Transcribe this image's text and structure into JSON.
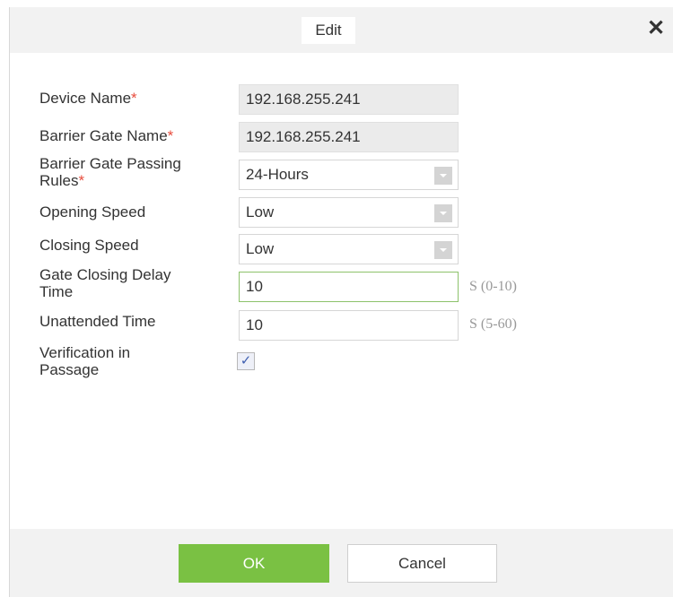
{
  "dialog": {
    "title": "Edit",
    "close_icon": "close-icon"
  },
  "form": {
    "device_name": {
      "label": "Device Name",
      "required_mark": "*",
      "value": "192.168.255.241"
    },
    "barrier_gate_name": {
      "label": "Barrier Gate Name",
      "required_mark": "*",
      "value": "192.168.255.241"
    },
    "passing_rules": {
      "label_line1": "Barrier Gate Passing",
      "label_line2": "Rules",
      "required_mark": "*",
      "value": "24-Hours"
    },
    "opening_speed": {
      "label": "Opening Speed",
      "value": "Low"
    },
    "closing_speed": {
      "label": "Closing Speed",
      "value": "Low"
    },
    "gate_closing_delay": {
      "label_line1": "Gate Closing Delay",
      "label_line2": "Time",
      "value": "10",
      "unit": "S",
      "range": "(0-10)"
    },
    "unattended_time": {
      "label": "Unattended Time",
      "value": "10",
      "unit": "S",
      "range": "(5-60)"
    },
    "verification": {
      "label_line1": "Verification in",
      "label_line2": "Passage",
      "checked": true,
      "check_glyph": "✓"
    }
  },
  "footer": {
    "ok_label": "OK",
    "cancel_label": "Cancel"
  },
  "colors": {
    "ok_button": "#7ac143",
    "required": "#e84c3d",
    "active_border": "#8dc26b"
  }
}
